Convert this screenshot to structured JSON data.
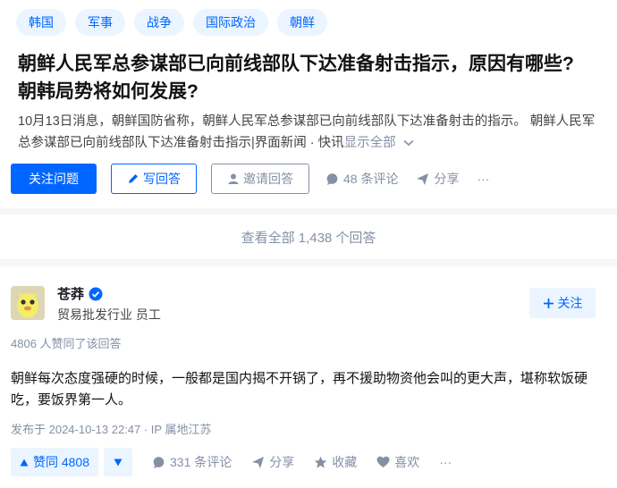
{
  "topics": [
    "韩国",
    "军事",
    "战争",
    "国际政治",
    "朝鲜"
  ],
  "question": {
    "title_line1": "朝鲜人民军总参谋部已向前线部队下达准备射击指示，原因有哪些?",
    "title_line2": "朝韩局势将如何发展?",
    "excerpt_line1": "10月13日消息，朝鲜国防省称，朝鲜人民军总参谋部已向前线部队下达准备射击的指示。 朝鲜人民军",
    "excerpt_line2": "总参谋部已向前线部队下达准备射击指示|界面新闻 · 快讯",
    "show_all": "显示全部",
    "follow_label": "关注问题",
    "write_label": "写回答",
    "invite_label": "邀请回答",
    "comments_label": "48 条评论",
    "share_label": "分享",
    "more_label": "···"
  },
  "all_answers": "查看全部 1,438 个回答",
  "answer": {
    "author_name": "苍莽",
    "author_bio": "贸易批发行业 员工",
    "follow_label": "关注",
    "upvote_note": "4806 人赞同了该回答",
    "text_line1": "朝鲜每次态度强硬的时候，一般都是国内揭不开锅了，再不援助物资他会叫的更大声，堪称软饭硬",
    "text_line2": "吃，要饭界第一人。",
    "meta": "发布于 2024-10-13 22:47 · IP 属地江苏",
    "vote_label": "赞同 4808",
    "comments_label": "331 条评论",
    "share_label": "分享",
    "collect_label": "收藏",
    "like_label": "喜欢",
    "more_label": "···"
  },
  "colors": {
    "accent": "#0066ff",
    "accent_bg": "#ebf5ff",
    "muted": "#8590a6"
  }
}
